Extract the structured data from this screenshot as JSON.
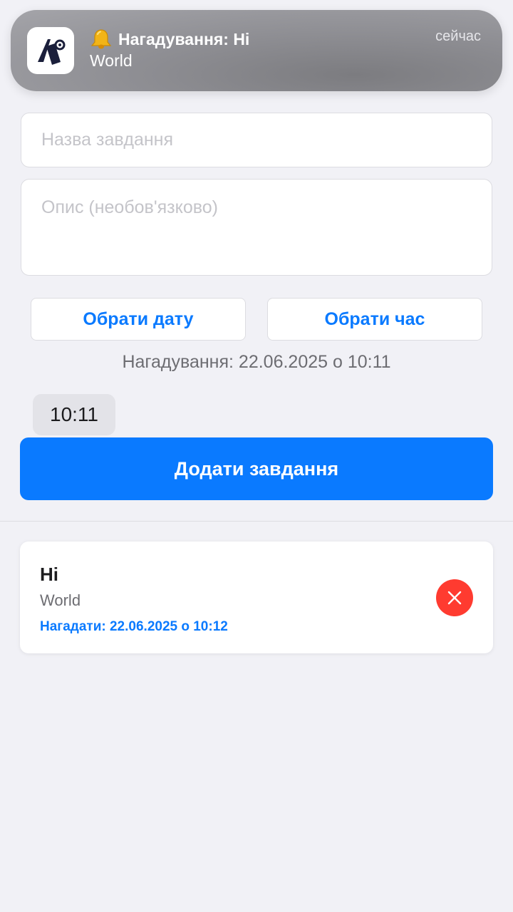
{
  "notification": {
    "title": "Нагадування: Hi",
    "body": "World",
    "time": "сейчас",
    "app_icon": "app-logo-icon",
    "title_icon": "bell-icon"
  },
  "form": {
    "title_placeholder": "Назва завдання",
    "description_placeholder": "Опис (необов'язково)",
    "pick_date_label": "Обрати дату",
    "pick_time_label": "Обрати час",
    "reminder_text": "Нагадування: 22.06.2025 о 10:11",
    "selected_time": "10:11",
    "add_button_label": "Додати завдання"
  },
  "tasks": [
    {
      "title": "Hi",
      "description": "World",
      "reminder": "Нагадати: 22.06.2025 о 10:12"
    }
  ],
  "colors": {
    "accent": "#0a7aff",
    "danger": "#ff3b30",
    "background": "#f1f1f6"
  }
}
